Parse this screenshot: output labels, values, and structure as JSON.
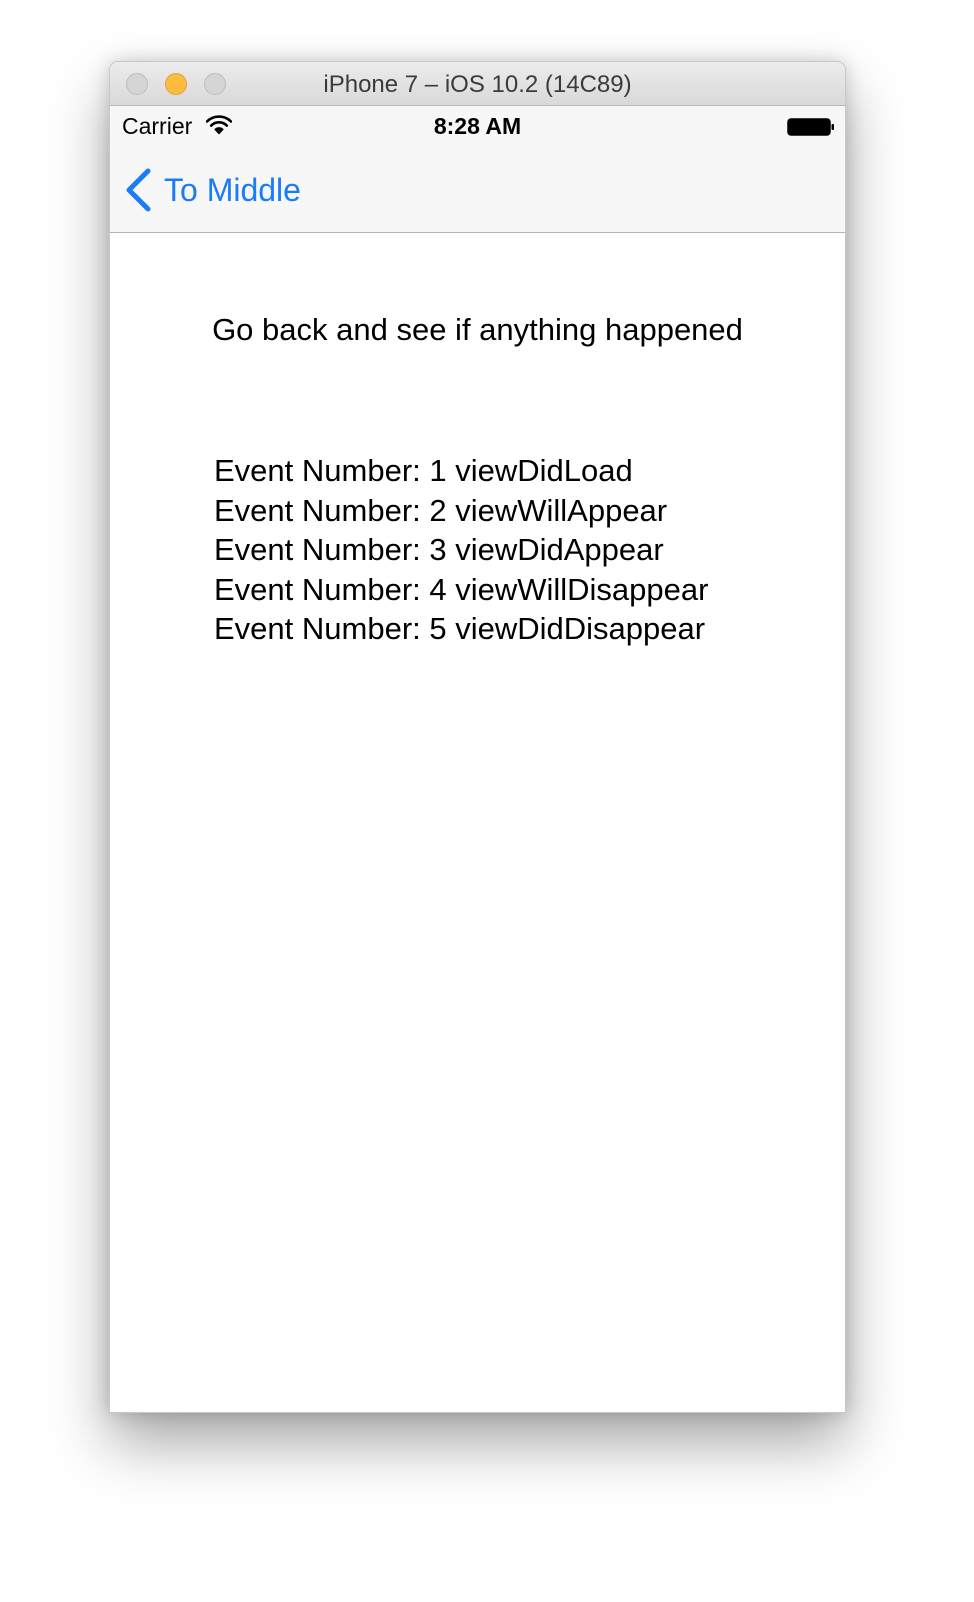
{
  "window": {
    "title": "iPhone 7 – iOS 10.2 (14C89)"
  },
  "status_bar": {
    "carrier": "Carrier",
    "time": "8:28 AM",
    "icons": [
      "wifi-icon",
      "battery-icon"
    ]
  },
  "nav_bar": {
    "back_label": "To Middle",
    "back_icon": "chevron-left-icon",
    "tint_color": "#1a7cf6"
  },
  "content": {
    "instruction": "Go back and see if anything happened",
    "events": [
      "Event Number: 1 viewDidLoad",
      "Event Number: 2 viewWillAppear",
      "Event Number: 3 viewDidAppear",
      "Event Number: 4 viewWillDisappear",
      "Event Number: 5 viewDidDisappear"
    ]
  },
  "colors": {
    "minimize_button": "#fdbc40",
    "inactive_buttons": "#d5d5d5"
  }
}
